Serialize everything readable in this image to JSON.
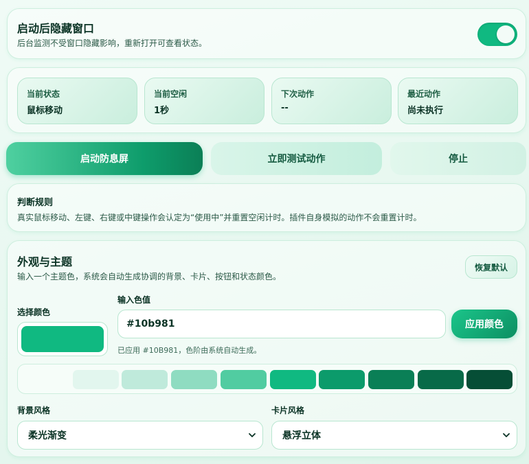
{
  "toggle_card": {
    "title": "启动后隐藏窗口",
    "description": "后台监测不受窗口隐藏影响，重新打开可查看状态。",
    "switch_on": true
  },
  "status": {
    "items": [
      {
        "label": "当前状态",
        "value": "鼠标移动"
      },
      {
        "label": "当前空闲",
        "value": "1秒"
      },
      {
        "label": "下次动作",
        "value": "--"
      },
      {
        "label": "最近动作",
        "value": "尚未执行"
      }
    ]
  },
  "actions": {
    "start_label": "启动防息屏",
    "test_label": "立即测试动作",
    "stop_label": "停止"
  },
  "rules": {
    "title": "判断规则",
    "body": "真实鼠标移动、左键、右键或中键操作会认定为“使用中”并重置空闲计时。插件自身模拟的动作不会重置计时。"
  },
  "theme": {
    "title": "外观与主题",
    "description": "输入一个主题色，系统会自动生成协调的背景、卡片、按钮和状态颜色。",
    "reset_label": "恢复默认",
    "pick_label": "选择颜色",
    "input_label": "输入色值",
    "hex_value": "#10b981",
    "apply_label": "应用颜色",
    "hint": "已应用 #10B981，色阶由系统自动生成。",
    "palette": [
      "#f6fdf9",
      "#e2f6ee",
      "#bfeadb",
      "#8fdcc1",
      "#51cca1",
      "#10b981",
      "#0c9b6b",
      "#0a7f56",
      "#086a48",
      "#064e36"
    ],
    "bg_label": "背景风格",
    "bg_value": "柔光渐变",
    "card_label": "卡片风格",
    "card_value": "悬浮立体"
  },
  "colors": {
    "accent": "#10b981",
    "text": "#0b3325"
  }
}
